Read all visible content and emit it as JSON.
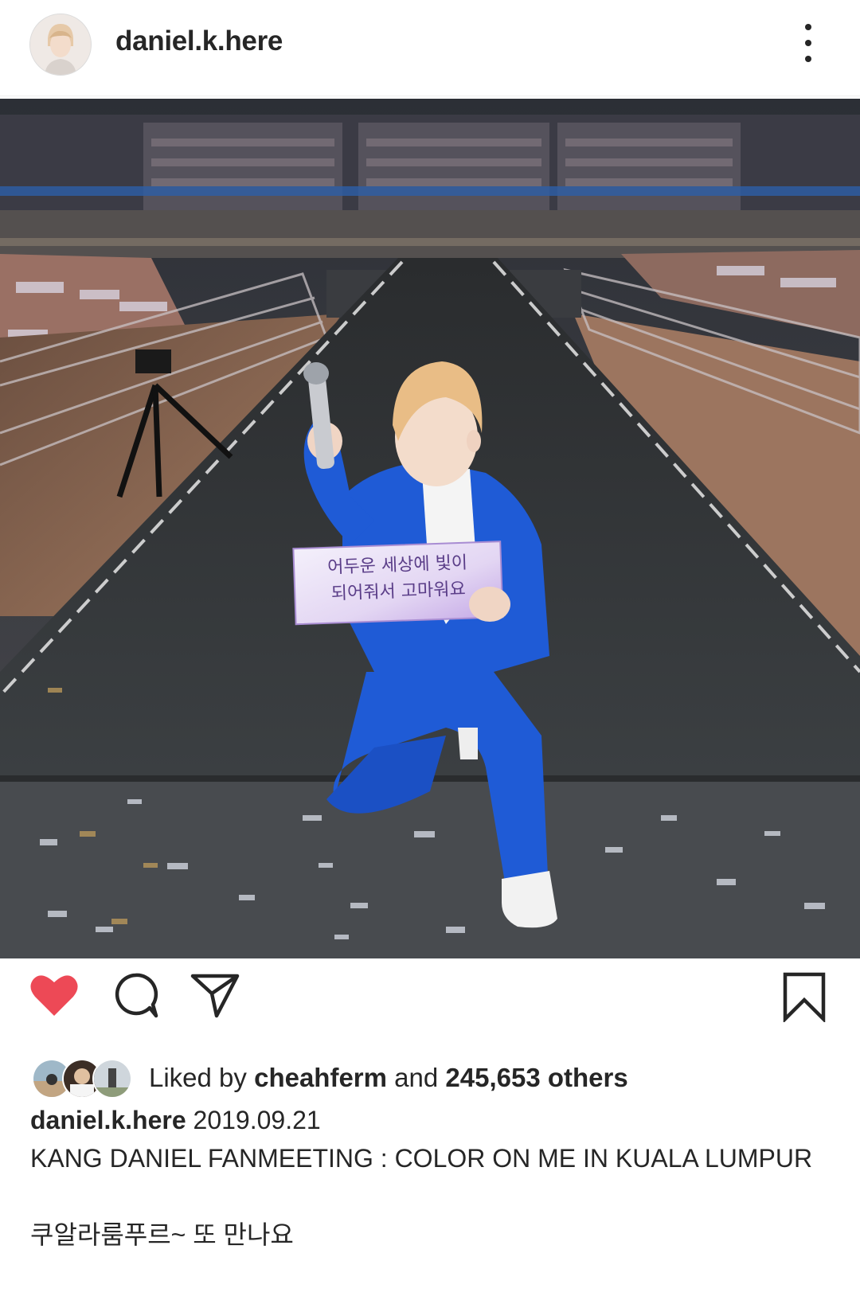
{
  "header": {
    "username": "daniel.k.here",
    "avatar_icon": "profile-avatar",
    "more_icon": "more-vertical-icon"
  },
  "photo": {
    "sign_line1": "어두운 세상에 빛이",
    "sign_line2": "되어줘서 고마워요",
    "icon": "photo-image"
  },
  "actions": {
    "like_icon": "heart-icon",
    "comment_icon": "comment-icon",
    "share_icon": "send-icon",
    "save_icon": "bookmark-icon",
    "like_color": "#ed4956"
  },
  "likes": {
    "prefix": "Liked by",
    "first_user": "cheahferm",
    "connector": "and",
    "others": "245,653 others"
  },
  "caption": {
    "username": "daniel.k.here",
    "date": "2019.09.21",
    "line1": "KANG DANIEL FANMEETING : COLOR ON ME IN KUALA LUMPUR",
    "line2": "쿠알라룸푸르~ 또 만나요"
  }
}
